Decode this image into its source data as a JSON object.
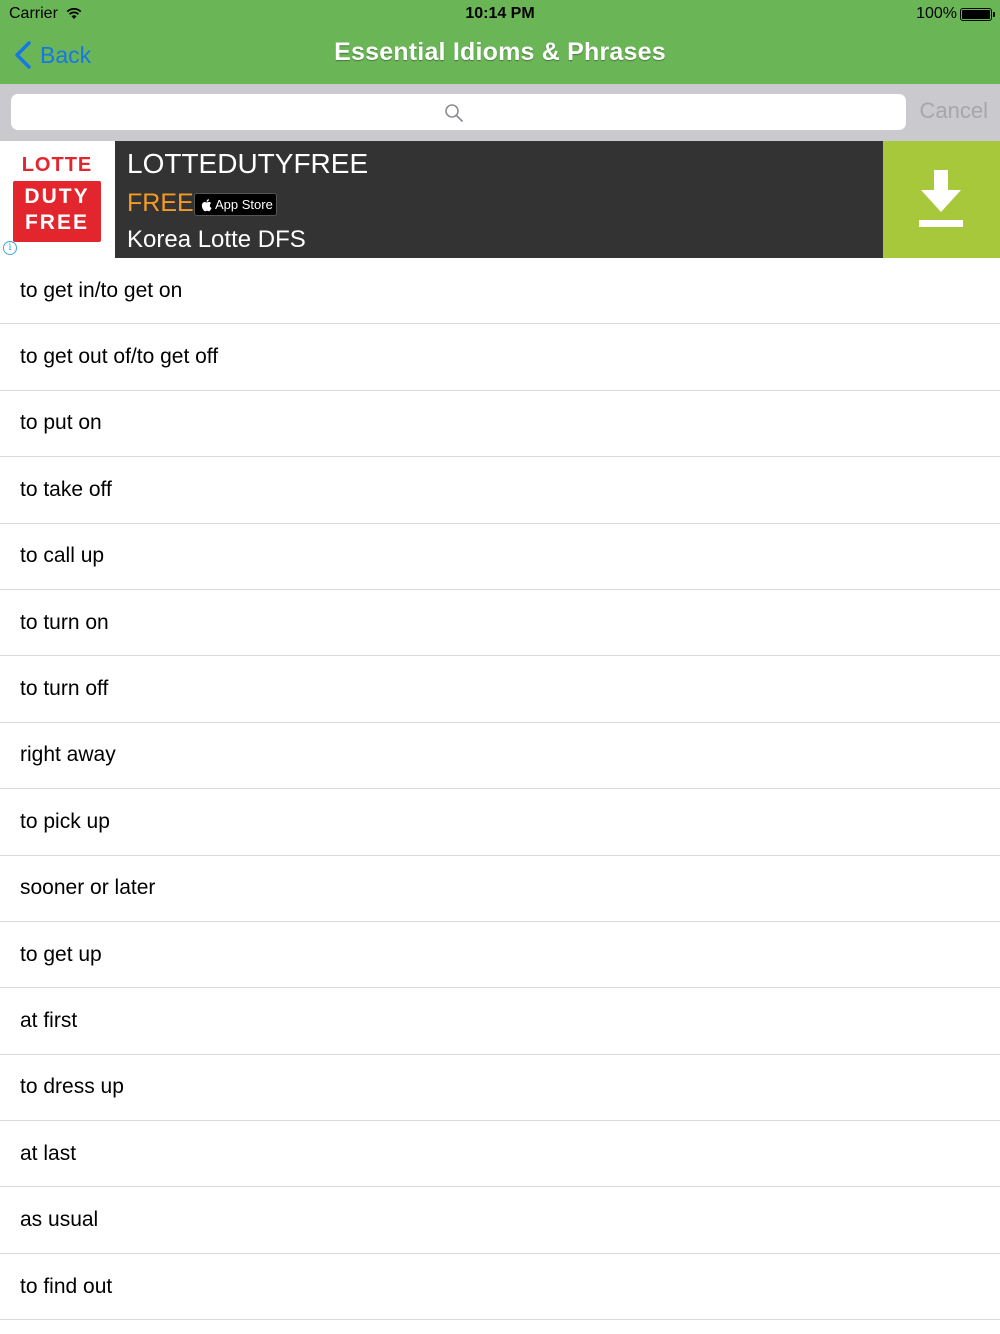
{
  "status": {
    "carrier": "Carrier",
    "time": "10:14 PM",
    "battery": "100%"
  },
  "nav": {
    "back_label": "Back",
    "title": "Essential Idioms & Phrases"
  },
  "search": {
    "value": "",
    "placeholder": "",
    "cancel_label": "Cancel"
  },
  "ad": {
    "logo_line1": "LOTTE",
    "logo_line2": "DUTY",
    "logo_line3": "FREE",
    "title": "LOTTEDUTYFREE",
    "price": "FREE",
    "store_badge": "App Store",
    "subtitle": "Korea Lotte DFS",
    "info": "i"
  },
  "colors": {
    "nav_bar": "#6ab556",
    "back_link": "#1677e8",
    "search_bar": "#c9c9ce",
    "ad_background": "#333333",
    "ad_free_text": "#f39a28",
    "ad_download": "#a8c83b",
    "logo_red": "#e3262d"
  },
  "icons": {
    "back": "chevron-left-icon",
    "search": "search-icon",
    "download": "download-icon",
    "wifi": "wifi-icon",
    "battery": "battery-icon",
    "apple": "apple-icon",
    "info": "info-icon"
  },
  "items": [
    "to get in/to get on",
    "to get out of/to get off",
    "to put on",
    "to take off",
    "to call up",
    "to turn on",
    "to turn off",
    "right away",
    "to pick up",
    "sooner or later",
    "to get up",
    "at first",
    "to dress up",
    "at last",
    "as usual",
    "to find out"
  ]
}
